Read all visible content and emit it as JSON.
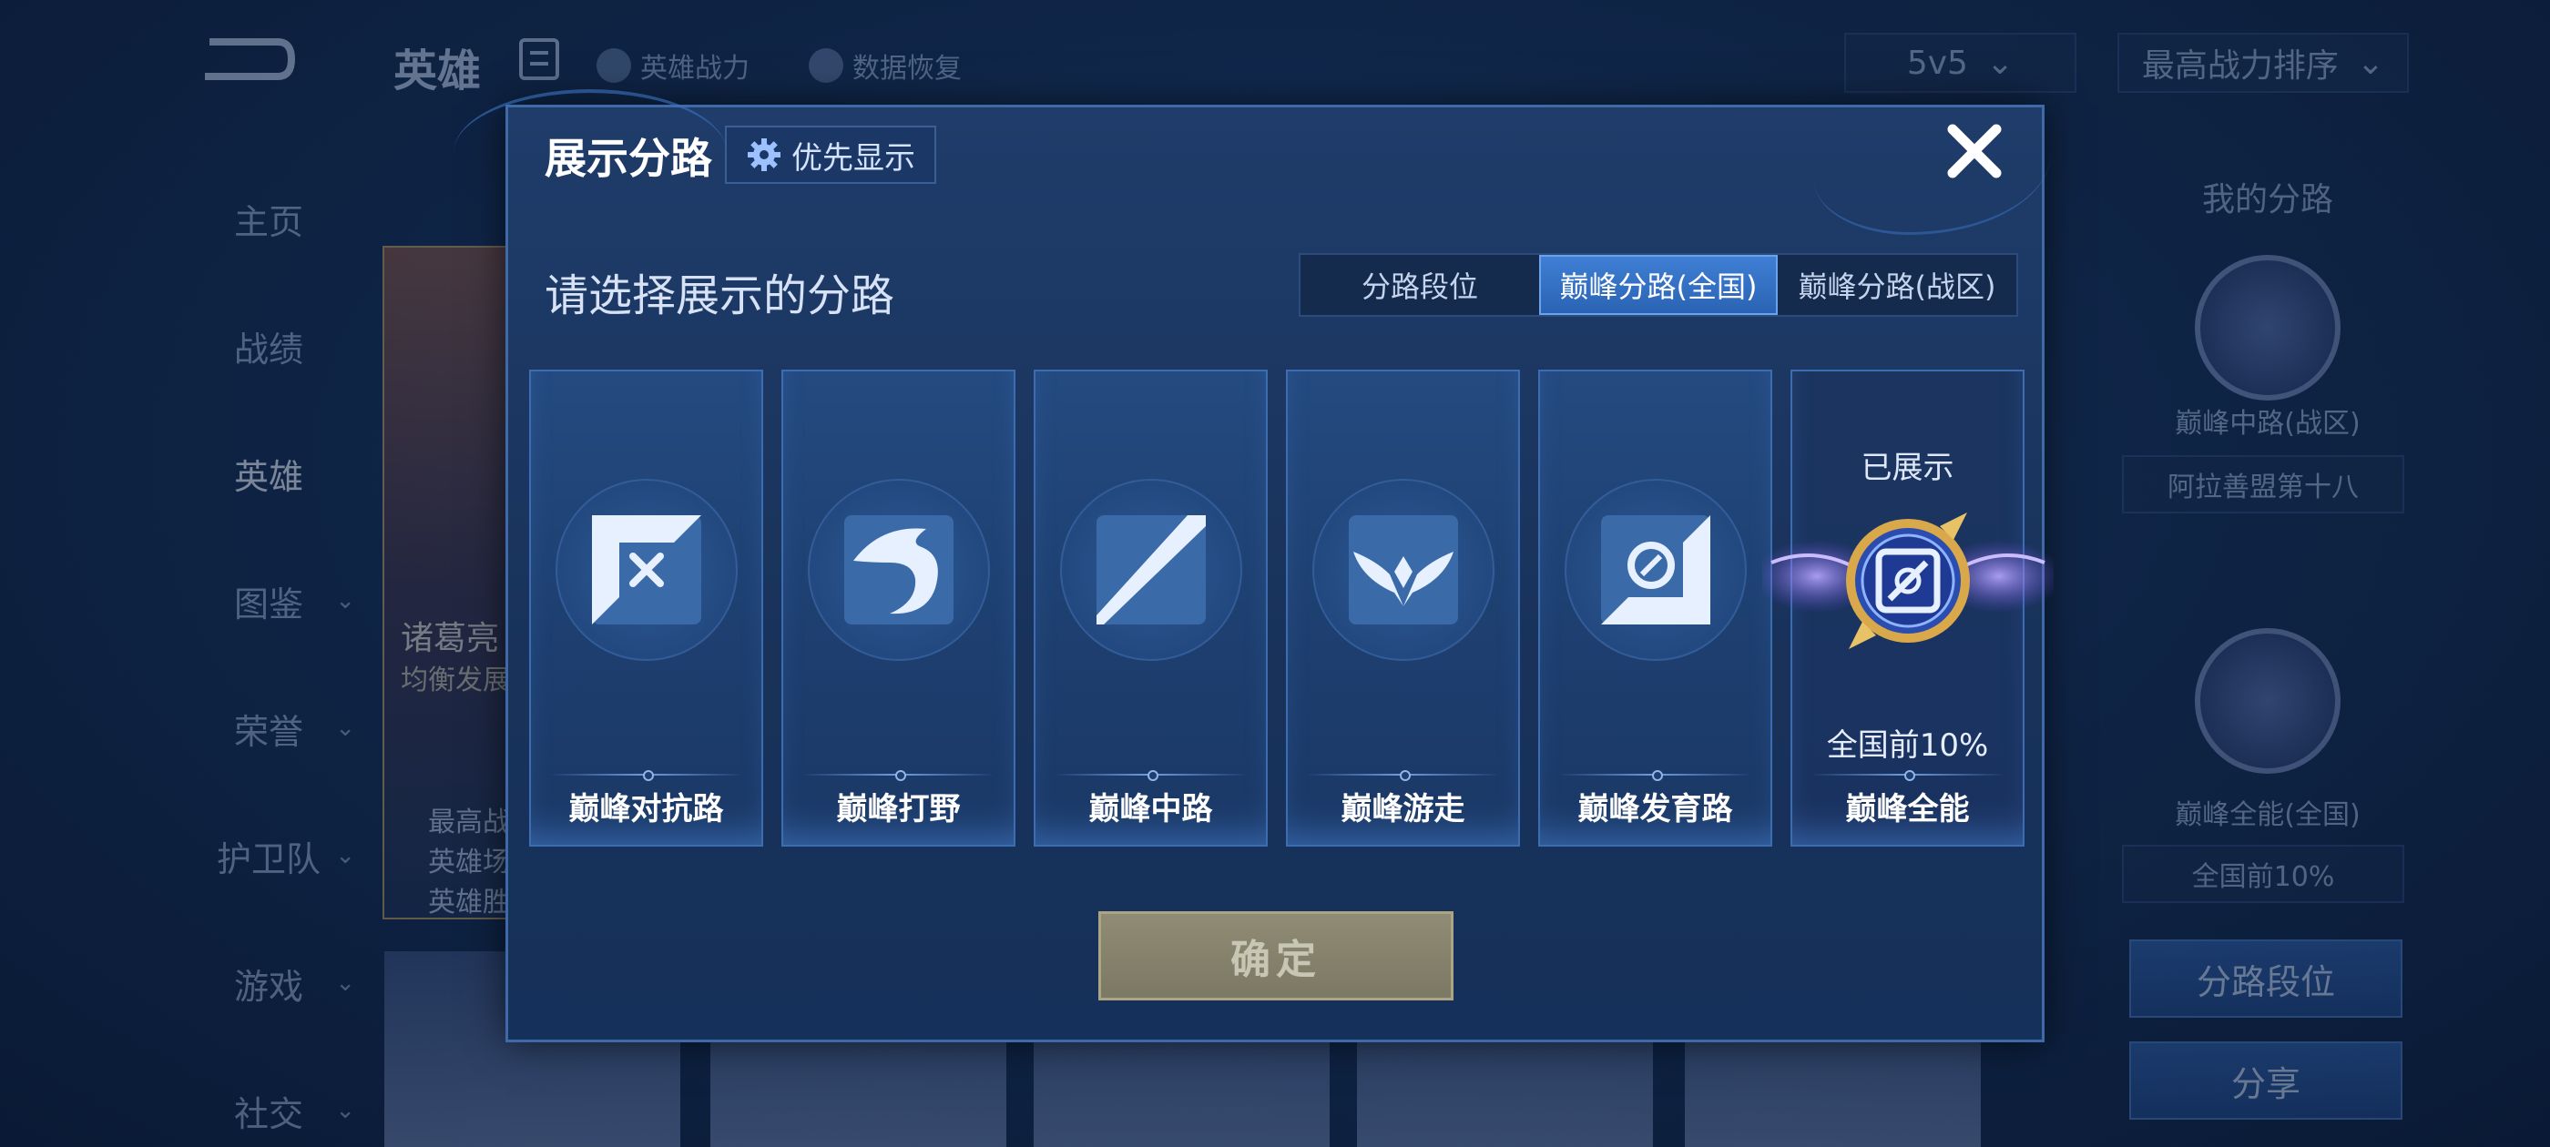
{
  "colors": {
    "accent": "#2a63b4",
    "modal_bg": "#1f3c6a",
    "confirm_disabled": "#a59c7a",
    "badge_gold": "#d8a84a"
  },
  "topbar": {
    "title": "英雄",
    "links": [
      {
        "label": "英雄战力",
        "icon": "helmet-icon"
      },
      {
        "label": "数据恢复",
        "icon": "restore-icon"
      }
    ],
    "mode_select": "5v5",
    "sort_select": "最高战力排序"
  },
  "sidebar": {
    "items": [
      {
        "label": "主页",
        "chevron": false,
        "active": false
      },
      {
        "label": "战绩",
        "chevron": false,
        "active": false
      },
      {
        "label": "英雄",
        "chevron": false,
        "active": true
      },
      {
        "label": "图鉴",
        "chevron": true,
        "active": false
      },
      {
        "label": "荣誉",
        "chevron": true,
        "active": false
      },
      {
        "label": "护卫队",
        "chevron": true,
        "active": false
      },
      {
        "label": "游戏",
        "chevron": true,
        "active": false
      },
      {
        "label": "社交",
        "chevron": true,
        "active": false
      }
    ]
  },
  "hero_card": {
    "name": "诸葛亮",
    "subtitle": "均衡发展",
    "stats": [
      "最高战",
      "英雄场",
      "英雄胜"
    ]
  },
  "right_panel": {
    "title": "我的分路",
    "lane1": "巅峰中路(战区)",
    "lane1_region": "阿拉善盟第十八",
    "lane2": "巅峰全能(全国)",
    "lane2_rank": "全国前10%",
    "btn_lane_rank": "分路段位",
    "btn_share": "分享"
  },
  "modal": {
    "title": "展示分路",
    "priority_label": "优先显示",
    "prompt": "请选择展示的分路",
    "tabs": [
      "分路段位",
      "巅峰分路(全国)",
      "巅峰分路(战区)"
    ],
    "active_tab": 1,
    "lanes": [
      {
        "name": "巅峰对抗路",
        "icon": "sword-cross-icon"
      },
      {
        "name": "巅峰打野",
        "icon": "dragon-icon"
      },
      {
        "name": "巅峰中路",
        "icon": "staff-icon"
      },
      {
        "name": "巅峰游走",
        "icon": "wings-icon"
      },
      {
        "name": "巅峰发育路",
        "icon": "target-icon"
      },
      {
        "name": "巅峰全能",
        "icon": "allround-badge-icon",
        "shown_label": "已展示",
        "rank": "全国前10%"
      }
    ],
    "confirm_label": "确定"
  }
}
